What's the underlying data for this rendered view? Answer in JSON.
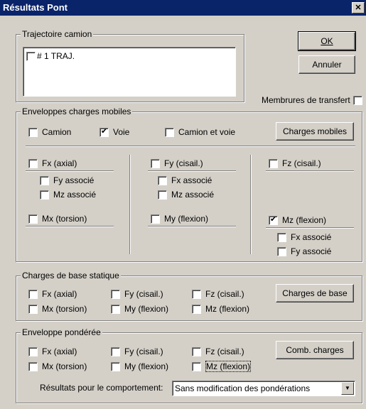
{
  "window": {
    "title": "Résultats Pont",
    "close": "✕"
  },
  "buttons": {
    "ok": "OK",
    "annuler": "Annuler",
    "charges_mobiles": "Charges mobiles",
    "charges_base": "Charges de base",
    "comb_charges": "Comb. charges"
  },
  "trajectoire": {
    "label": "Trajectoire camion",
    "items": [
      {
        "label": "# 1  TRAJ.",
        "checked": false
      }
    ]
  },
  "membrures": {
    "label": "Membrures de transfert",
    "checked": false
  },
  "env_mobiles": {
    "label": "Enveloppes charges mobiles",
    "camion": "Camion",
    "camion_checked": false,
    "voie": "Voie",
    "voie_checked": true,
    "camion_voie": "Camion et voie",
    "camion_voie_checked": false,
    "fx_axial": "Fx (axial)",
    "fy_associe": "Fy associé",
    "mz_associe": "Mz associé",
    "mx_torsion": "Mx (torsion)",
    "fy_cisail": "Fy (cisail.)",
    "fx_associe": "Fx associé",
    "mz_associe2": "Mz associé",
    "my_flexion": "My (flexion)",
    "fz_cisail": "Fz (cisail.)",
    "mz_flexion": "Mz (flexion)",
    "mz_flexion_checked": true,
    "fx_associe2": "Fx associé",
    "fy_associe2": "Fy associé"
  },
  "charges_base": {
    "label": "Charges de base statique",
    "fx": "Fx (axial)",
    "fy": "Fy (cisail.)",
    "fz": "Fz (cisail.)",
    "mx": "Mx (torsion)",
    "my": "My (flexion)",
    "mz": "Mz (flexion)"
  },
  "env_ponderee": {
    "label": "Enveloppe pondérée",
    "fx": "Fx (axial)",
    "fy": "Fy (cisail.)",
    "fz": "Fz (cisail.)",
    "mx": "Mx (torsion)",
    "my": "My (flexion)",
    "mz": "Mz (flexion)",
    "resultats_label": "Résultats pour le comportement:",
    "resultats_value": "Sans modification des pondérations"
  }
}
